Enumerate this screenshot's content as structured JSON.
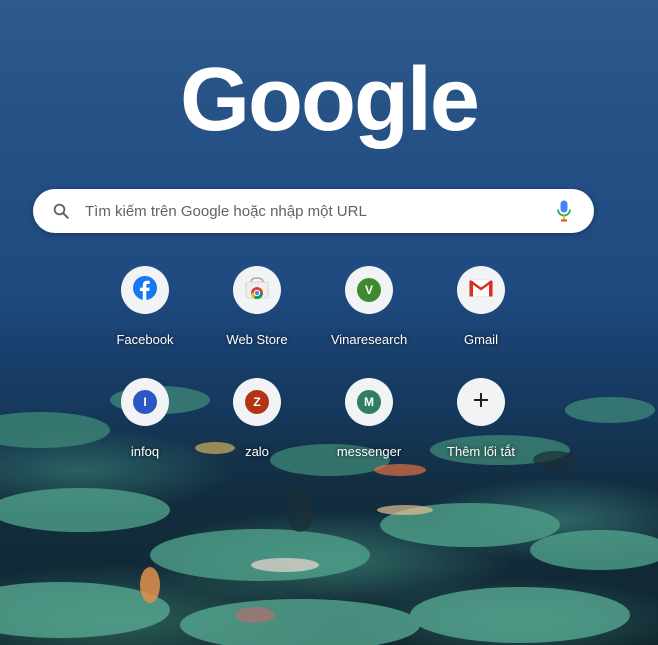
{
  "logo": {
    "text": "Google"
  },
  "search": {
    "placeholder": "Tìm kiếm trên Google hoặc nhập một URL",
    "search_icon": "search-icon",
    "mic_icon": "microphone-icon"
  },
  "shortcuts": [
    {
      "label": "Facebook",
      "icon": "facebook-icon",
      "color": "#1877f2"
    },
    {
      "label": "Web Store",
      "icon": "chrome-web-store-icon"
    },
    {
      "label": "Vinaresearch",
      "letter": "V",
      "color": "#3e8a2e"
    },
    {
      "label": "Gmail",
      "icon": "gmail-icon",
      "color": "#d93025"
    },
    {
      "label": "infoq",
      "letter": "I",
      "color": "#2b57c2"
    },
    {
      "label": "zalo",
      "letter": "Z",
      "color": "#b23414"
    },
    {
      "label": "messenger",
      "letter": "M",
      "color": "#2f7d63"
    },
    {
      "label": "Thêm lối tắt",
      "icon": "plus-icon"
    }
  ]
}
